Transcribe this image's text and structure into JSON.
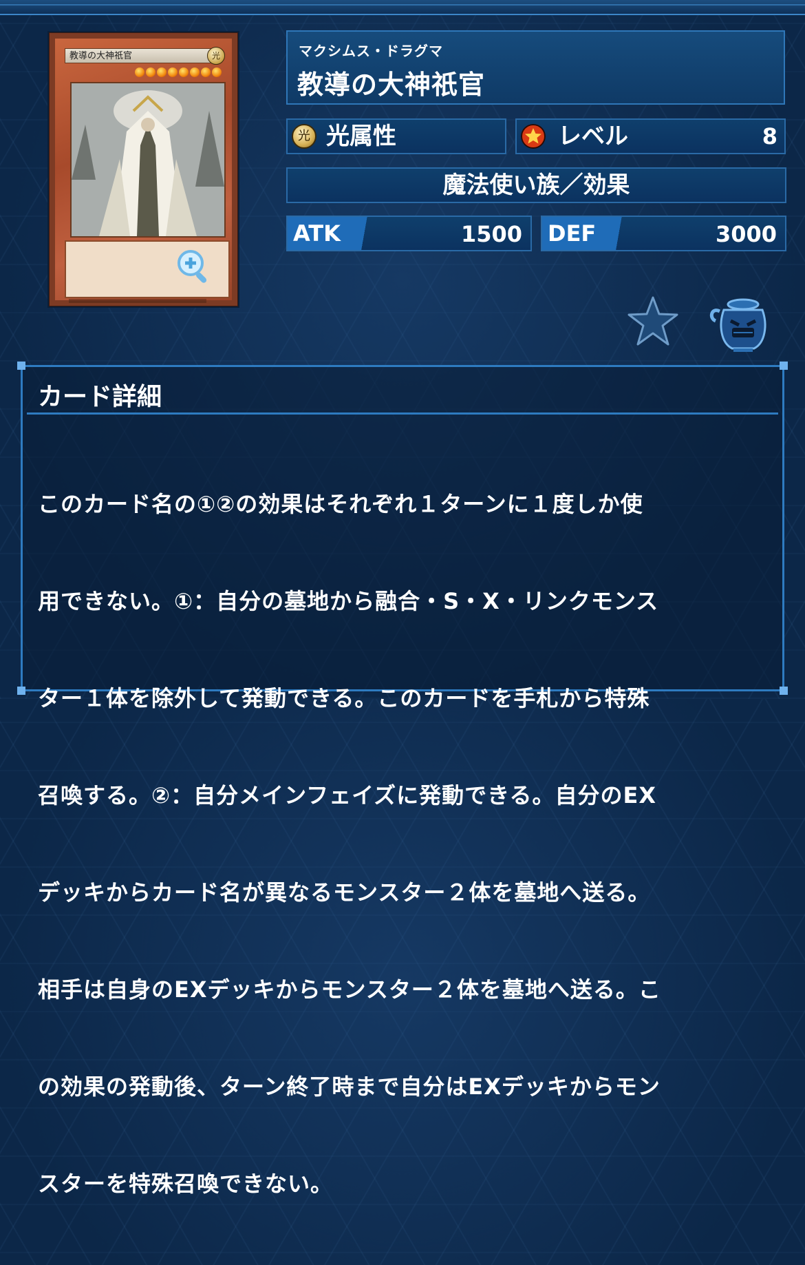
{
  "card": {
    "name_on_card": "教導の大神祇官",
    "attribute_glyph": "光",
    "stars": 8
  },
  "info": {
    "ruby": "マクシムス・ドラグマ",
    "name": "教導の大神祇官",
    "attribute_icon_text": "光",
    "attribute_label": "光属性",
    "level_label": "レベル",
    "level_value": "8",
    "type_line": "魔法使い族／効果",
    "atk_label": "ATK",
    "atk_value": "1500",
    "def_label": "DEF",
    "def_value": "3000"
  },
  "icons": {
    "favorite": "star-icon",
    "deck": "pot-icon",
    "zoom": "zoom-in-icon"
  },
  "detail": {
    "title": "カード詳細",
    "lines": [
      "このカード名の①②の効果はそれぞれ１ターンに１度しか使",
      "用できない。①：自分の墓地から融合・S・X・リンクモンス",
      "ター１体を除外して発動できる。このカードを手札から特殊",
      "召喚する。②：自分メインフェイズに発動できる。自分のEX",
      "デッキからカード名が異なるモンスター２体を墓地へ送る。",
      "相手は自身のEXデッキからモンスター２体を墓地へ送る。こ",
      "の効果の発動後、ターン終了時まで自分はEXデッキからモン",
      "スターを特殊召喚できない。"
    ]
  },
  "colors": {
    "background": "#0c2748",
    "panel_border": "#2e7bc0",
    "stat_tag": "#1f6cb8",
    "card_frame": "#c9663e"
  }
}
